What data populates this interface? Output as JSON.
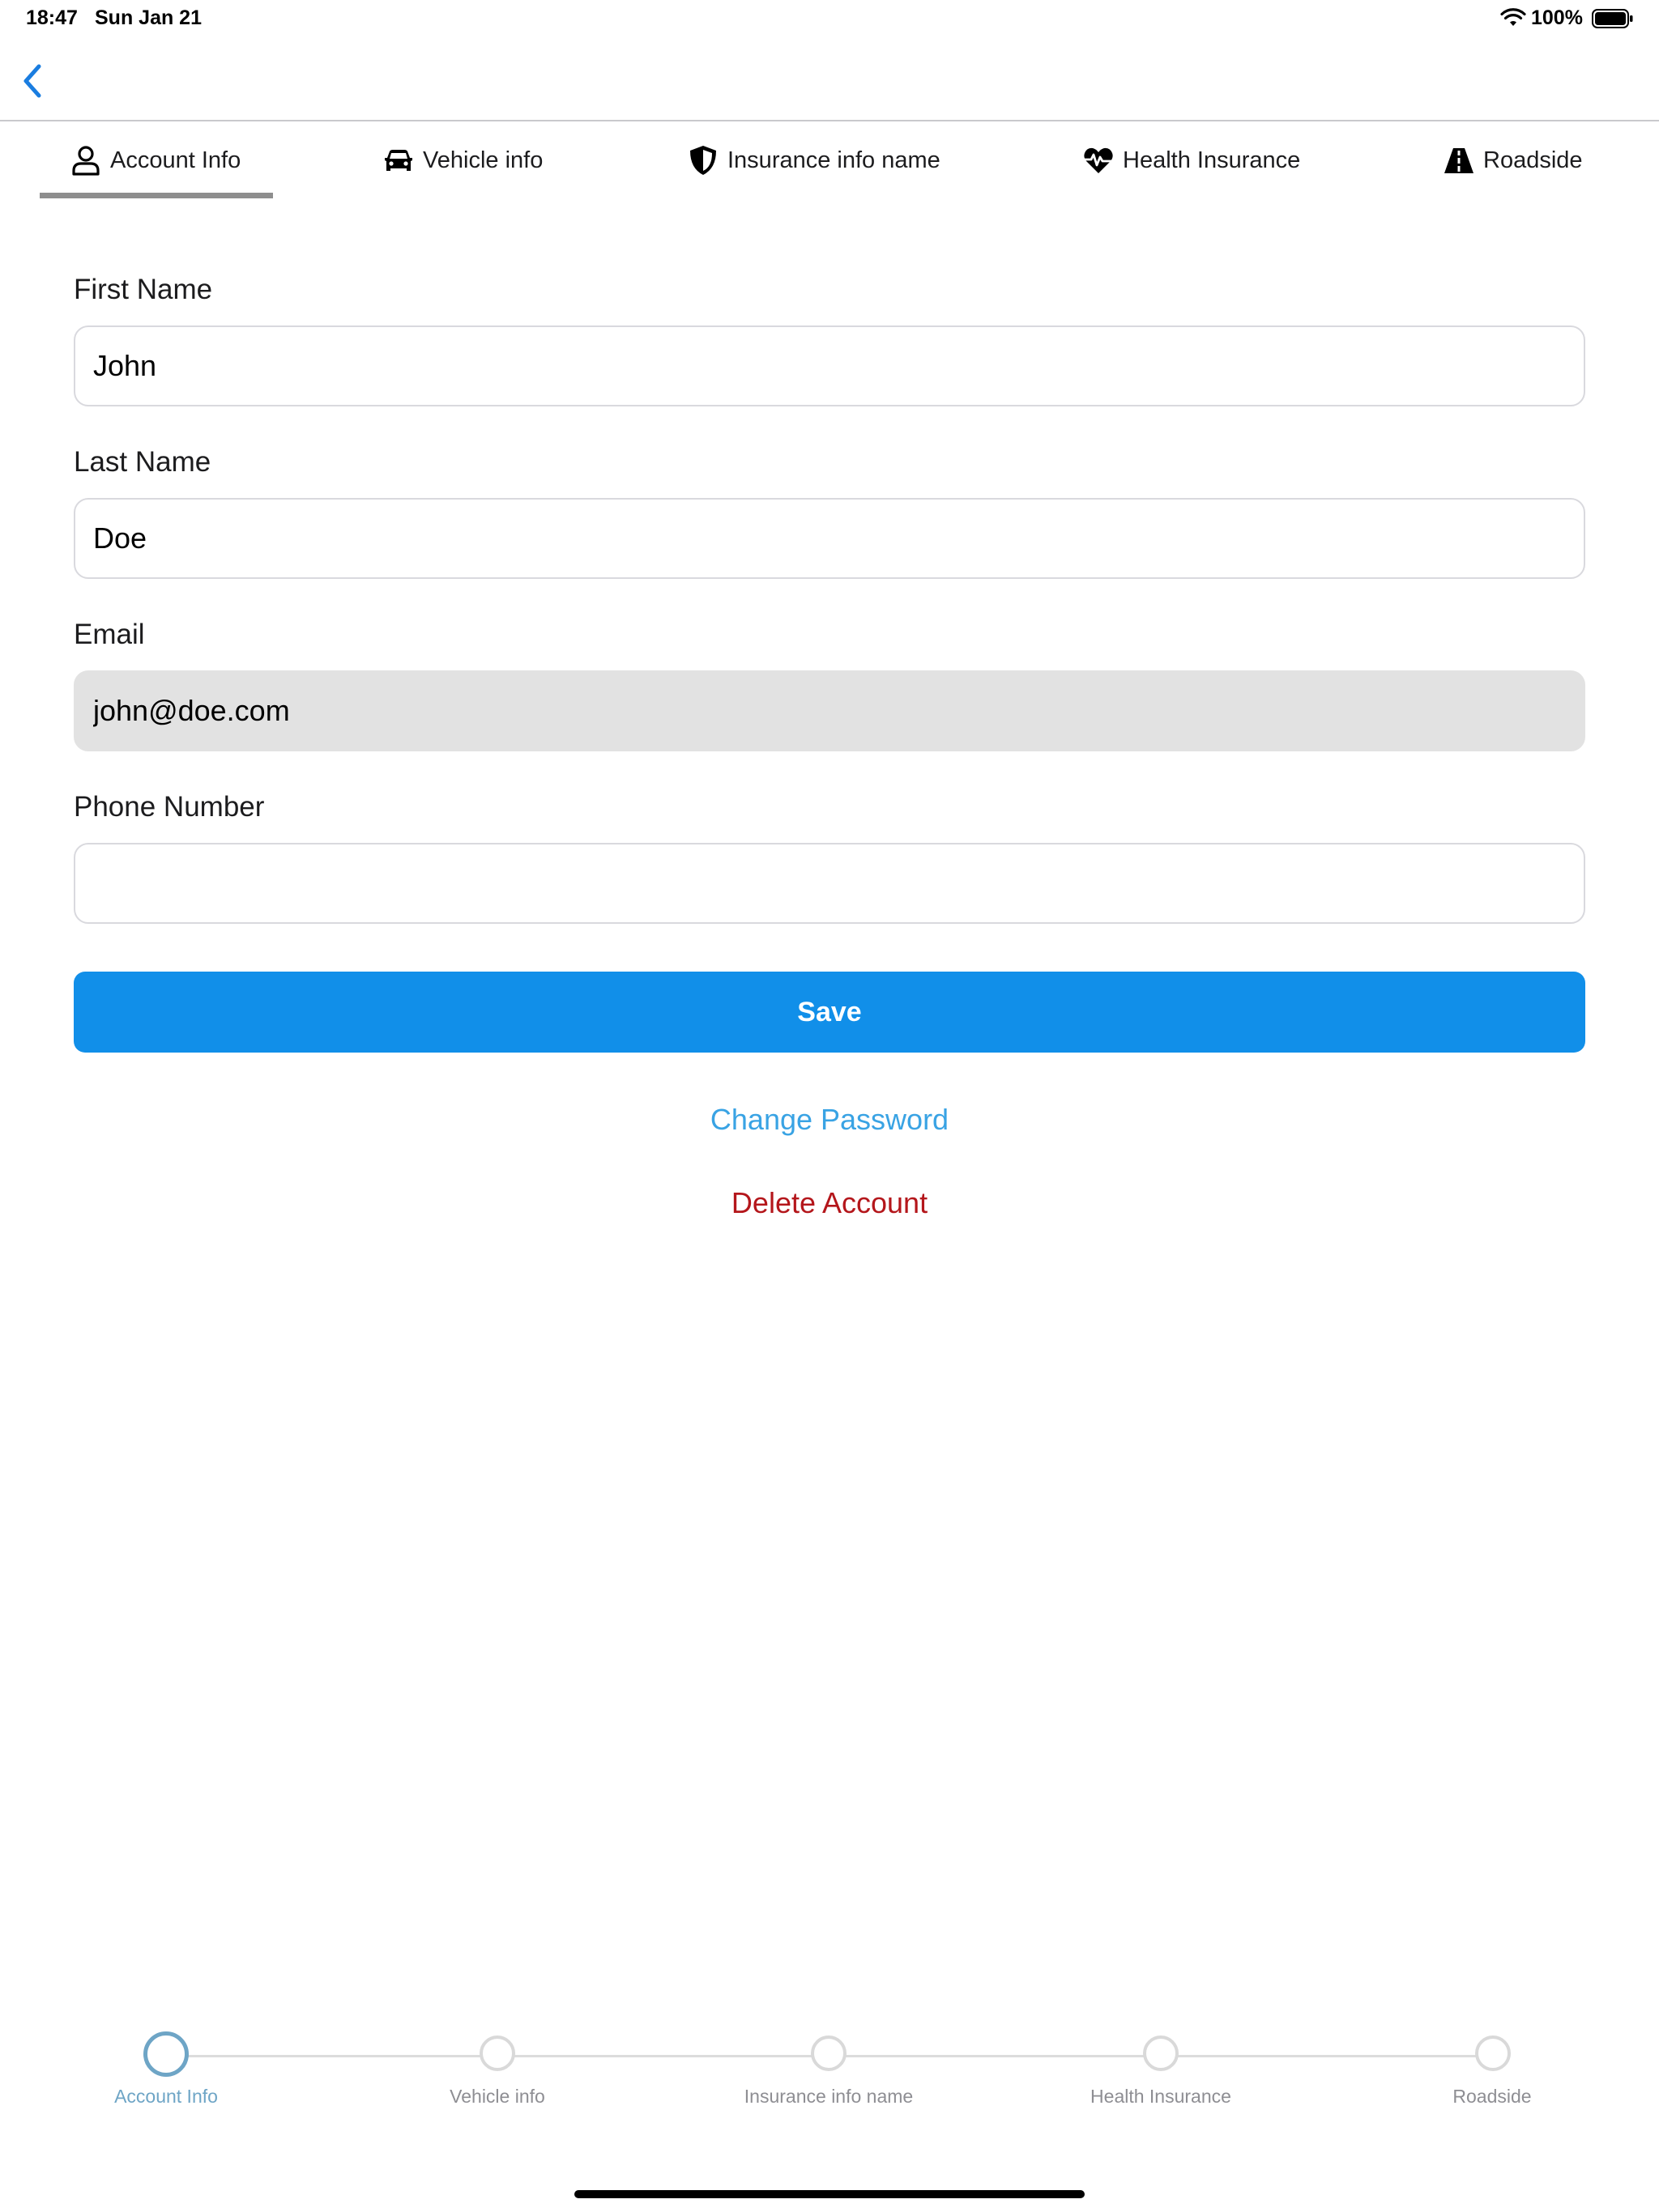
{
  "status_bar": {
    "time": "18:47",
    "date": "Sun Jan 21",
    "battery": "100%",
    "icons": [
      "wifi-icon",
      "battery-icon"
    ]
  },
  "nav": {
    "back_icon": "chevron-left-icon"
  },
  "tabs": [
    {
      "label": "Account Info",
      "icon": "person-icon",
      "active": true
    },
    {
      "label": "Vehicle info",
      "icon": "car-icon",
      "active": false
    },
    {
      "label": "Insurance info name",
      "icon": "shield-icon",
      "active": false
    },
    {
      "label": "Health Insurance",
      "icon": "heart-pulse-icon",
      "active": false
    },
    {
      "label": "Roadside",
      "icon": "road-icon",
      "active": false
    }
  ],
  "form": {
    "first_name": {
      "label": "First Name",
      "value": "John"
    },
    "last_name": {
      "label": "Last Name",
      "value": "Doe"
    },
    "email": {
      "label": "Email",
      "value": "john@doe.com",
      "disabled": true
    },
    "phone": {
      "label": "Phone Number",
      "value": ""
    }
  },
  "actions": {
    "save_label": "Save",
    "change_password_label": "Change Password",
    "delete_account_label": "Delete Account"
  },
  "stepper": {
    "current_step": 1,
    "steps": [
      "Account Info",
      "Vehicle info",
      "Insurance info name",
      "Health Insurance",
      "Roadside"
    ]
  },
  "colors": {
    "accent": "#118fe9",
    "link": "#39a3e4",
    "danger": "#b4161b",
    "stepper_active": "#6ea5c6"
  }
}
